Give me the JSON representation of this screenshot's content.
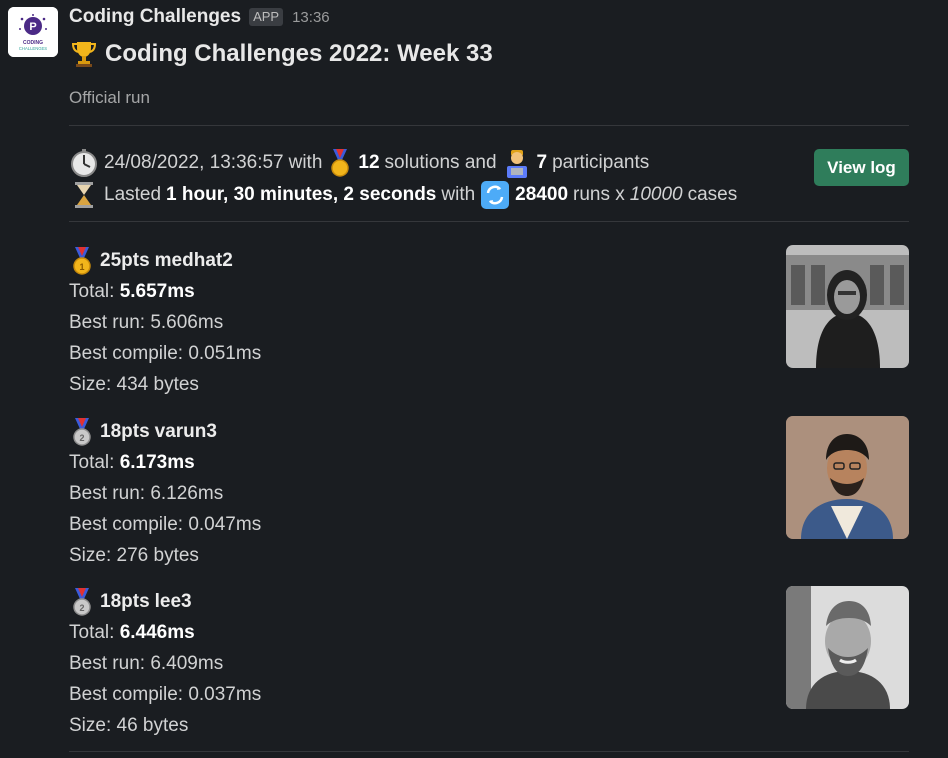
{
  "app": {
    "name": "Coding Challenges",
    "badge": "APP",
    "time": "13:36",
    "logo_text": "CODING CHALLENGES"
  },
  "message": {
    "title": "Coding Challenges 2022: Week 33",
    "subtitle": "Official run"
  },
  "summary": {
    "datetime": "24/08/2022, 13:36:57",
    "with_1": "with",
    "solutions_count": "12",
    "solutions_label": "solutions and",
    "participants_count": "7",
    "participants_label": "participants",
    "lasted_label": "Lasted",
    "duration": "1 hour, 30 minutes, 2 seconds",
    "with_2": "with",
    "runs_count": "28400",
    "runs_label": "runs x",
    "cases_count": "10000",
    "cases_label": "cases"
  },
  "view_log_label": "View log",
  "entries": [
    {
      "medal": "gold-medal-icon",
      "points": "25pts",
      "name": "medhat2",
      "total_label": "Total:",
      "total": "5.657ms",
      "best_run": "Best run: 5.606ms",
      "best_compile": "Best compile: 0.051ms",
      "size": "Size: 434 bytes"
    },
    {
      "medal": "silver-medal-icon",
      "points": "18pts",
      "name": "varun3",
      "total_label": "Total:",
      "total": "6.173ms",
      "best_run": "Best run: 6.126ms",
      "best_compile": "Best compile: 0.047ms",
      "size": "Size: 276 bytes"
    },
    {
      "medal": "silver-medal-icon",
      "points": "18pts",
      "name": "lee3",
      "total_label": "Total:",
      "total": "6.446ms",
      "best_run": "Best run: 6.409ms",
      "best_compile": "Best compile: 0.037ms",
      "size": "Size: 46 bytes"
    }
  ],
  "colors": {
    "background": "#1a1d21",
    "button": "#2f7d5b",
    "text": "#d1d2d3"
  }
}
